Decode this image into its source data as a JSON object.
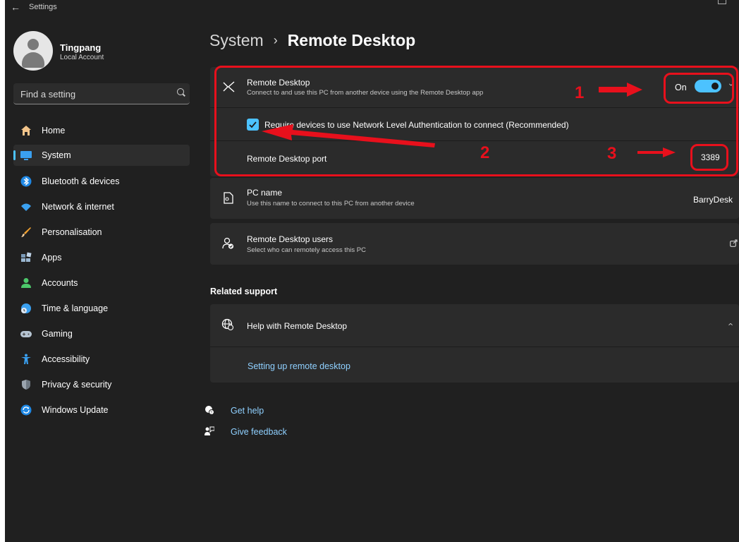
{
  "window": {
    "title": "Settings"
  },
  "profile": {
    "name": "Tingpang",
    "account_type": "Local Account"
  },
  "search": {
    "placeholder": "Find a setting"
  },
  "nav": {
    "items": [
      {
        "label": "Home",
        "icon": "home-icon",
        "active": false
      },
      {
        "label": "System",
        "icon": "monitor-icon",
        "active": true
      },
      {
        "label": "Bluetooth & devices",
        "icon": "bluetooth-icon",
        "active": false
      },
      {
        "label": "Network & internet",
        "icon": "wifi-icon",
        "active": false
      },
      {
        "label": "Personalisation",
        "icon": "brush-icon",
        "active": false
      },
      {
        "label": "Apps",
        "icon": "apps-icon",
        "active": false
      },
      {
        "label": "Accounts",
        "icon": "account-icon",
        "active": false
      },
      {
        "label": "Time & language",
        "icon": "globe-clock-icon",
        "active": false
      },
      {
        "label": "Gaming",
        "icon": "gamepad-icon",
        "active": false
      },
      {
        "label": "Accessibility",
        "icon": "accessibility-icon",
        "active": false
      },
      {
        "label": "Privacy & security",
        "icon": "shield-icon",
        "active": false
      },
      {
        "label": "Windows Update",
        "icon": "update-icon",
        "active": false
      }
    ]
  },
  "breadcrumb": {
    "parent": "System",
    "separator": "›",
    "current": "Remote Desktop"
  },
  "remote_desktop": {
    "title": "Remote Desktop",
    "description": "Connect to and use this PC from another device using the Remote Desktop app",
    "toggle_label": "On",
    "toggle_on": true,
    "nla_label": "Require devices to use Network Level Authentication to connect (Recommended)",
    "nla_checked": true,
    "port_label": "Remote Desktop port",
    "port_value": "3389"
  },
  "pc_name": {
    "title": "PC name",
    "description": "Use this name to connect to this PC from another device",
    "value": "BarryDesk"
  },
  "rd_users": {
    "title": "Remote Desktop users",
    "description": "Select who can remotely access this PC"
  },
  "related_support": {
    "heading": "Related support",
    "help_title": "Help with Remote Desktop",
    "link": "Setting up remote desktop"
  },
  "footer": {
    "get_help": "Get help",
    "give_feedback": "Give feedback"
  },
  "annotations": {
    "one": "1",
    "two": "2",
    "three": "3"
  },
  "colors": {
    "background": "#202020",
    "card": "#2b2b2b",
    "accent": "#4cc2ff",
    "annotation": "#e8101c"
  }
}
